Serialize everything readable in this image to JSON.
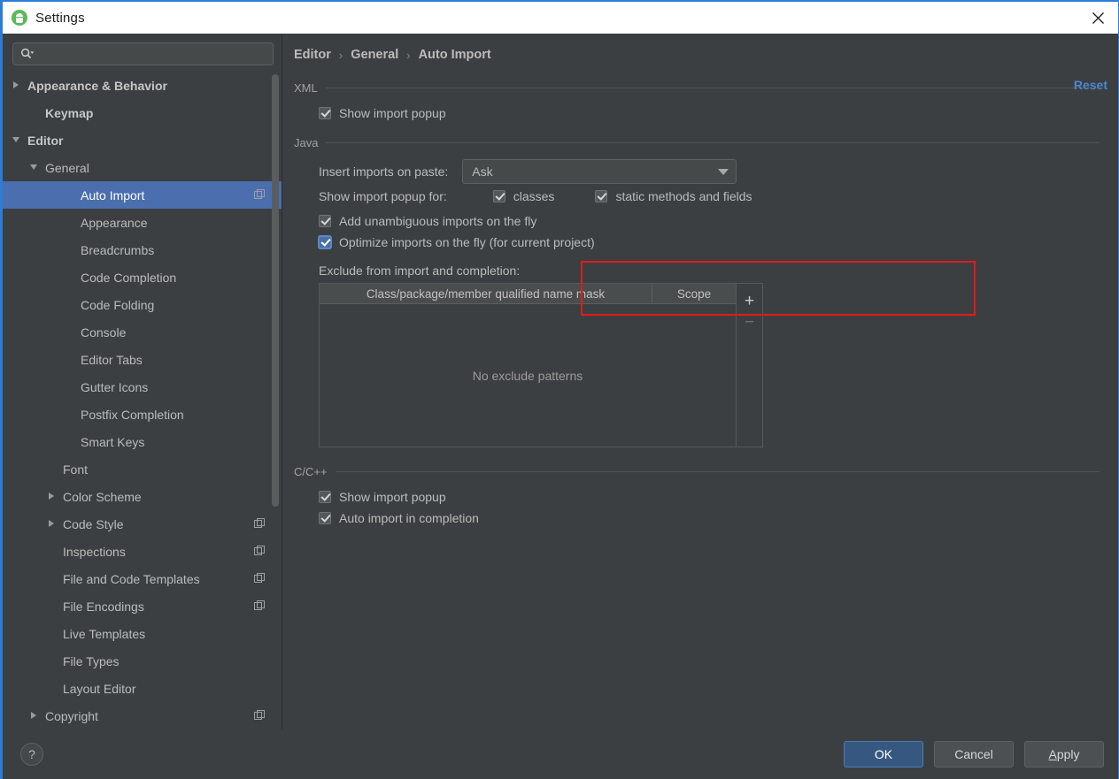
{
  "window": {
    "title": "Settings",
    "app_icon": "android-studio-icon",
    "close_icon": "close-icon",
    "accent_color": "#2d7cd6"
  },
  "sidebar": {
    "search": {
      "placeholder": "",
      "value": "",
      "icon": "search-icon"
    },
    "items": [
      {
        "label": "Appearance & Behavior",
        "indent": 0,
        "arrow": "right",
        "bold": true,
        "project_icon": false,
        "selected": false
      },
      {
        "label": "Keymap",
        "indent": 1,
        "arrow": "none",
        "bold": true,
        "project_icon": false,
        "selected": false
      },
      {
        "label": "Editor",
        "indent": 0,
        "arrow": "down",
        "bold": true,
        "project_icon": false,
        "selected": false
      },
      {
        "label": "General",
        "indent": 1,
        "arrow": "down",
        "bold": false,
        "project_icon": false,
        "selected": false
      },
      {
        "label": "Auto Import",
        "indent": 3,
        "arrow": "none",
        "bold": false,
        "project_icon": true,
        "selected": true
      },
      {
        "label": "Appearance",
        "indent": 3,
        "arrow": "none",
        "bold": false,
        "project_icon": false,
        "selected": false
      },
      {
        "label": "Breadcrumbs",
        "indent": 3,
        "arrow": "none",
        "bold": false,
        "project_icon": false,
        "selected": false
      },
      {
        "label": "Code Completion",
        "indent": 3,
        "arrow": "none",
        "bold": false,
        "project_icon": false,
        "selected": false
      },
      {
        "label": "Code Folding",
        "indent": 3,
        "arrow": "none",
        "bold": false,
        "project_icon": false,
        "selected": false
      },
      {
        "label": "Console",
        "indent": 3,
        "arrow": "none",
        "bold": false,
        "project_icon": false,
        "selected": false
      },
      {
        "label": "Editor Tabs",
        "indent": 3,
        "arrow": "none",
        "bold": false,
        "project_icon": false,
        "selected": false
      },
      {
        "label": "Gutter Icons",
        "indent": 3,
        "arrow": "none",
        "bold": false,
        "project_icon": false,
        "selected": false
      },
      {
        "label": "Postfix Completion",
        "indent": 3,
        "arrow": "none",
        "bold": false,
        "project_icon": false,
        "selected": false
      },
      {
        "label": "Smart Keys",
        "indent": 3,
        "arrow": "none",
        "bold": false,
        "project_icon": false,
        "selected": false
      },
      {
        "label": "Font",
        "indent": 2,
        "arrow": "none",
        "bold": false,
        "project_icon": false,
        "selected": false
      },
      {
        "label": "Color Scheme",
        "indent": 2,
        "arrow": "right",
        "bold": false,
        "project_icon": false,
        "selected": false
      },
      {
        "label": "Code Style",
        "indent": 2,
        "arrow": "right",
        "bold": false,
        "project_icon": true,
        "selected": false
      },
      {
        "label": "Inspections",
        "indent": 2,
        "arrow": "none",
        "bold": false,
        "project_icon": true,
        "selected": false
      },
      {
        "label": "File and Code Templates",
        "indent": 2,
        "arrow": "none",
        "bold": false,
        "project_icon": true,
        "selected": false
      },
      {
        "label": "File Encodings",
        "indent": 2,
        "arrow": "none",
        "bold": false,
        "project_icon": true,
        "selected": false
      },
      {
        "label": "Live Templates",
        "indent": 2,
        "arrow": "none",
        "bold": false,
        "project_icon": false,
        "selected": false
      },
      {
        "label": "File Types",
        "indent": 2,
        "arrow": "none",
        "bold": false,
        "project_icon": false,
        "selected": false
      },
      {
        "label": "Layout Editor",
        "indent": 2,
        "arrow": "none",
        "bold": false,
        "project_icon": false,
        "selected": false
      },
      {
        "label": "Copyright",
        "indent": 1,
        "arrow": "right",
        "bold": false,
        "project_icon": true,
        "selected": false
      }
    ]
  },
  "main": {
    "breadcrumb": {
      "items": [
        "Editor",
        "General",
        "Auto Import"
      ],
      "separator": "›"
    },
    "reset_label": "Reset",
    "reset_color": "#4a87d3",
    "groups": {
      "xml": {
        "title": "XML",
        "show_import_popup": {
          "label": "Show import popup",
          "checked": true
        }
      },
      "java": {
        "title": "Java",
        "insert_imports_label": "Insert imports on paste:",
        "insert_imports_value": "Ask",
        "show_import_popup_for_label": "Show import popup for:",
        "classes": {
          "label": "classes",
          "checked": true
        },
        "static_methods": {
          "label": "static methods and fields",
          "checked": true
        },
        "add_unambiguous": {
          "label": "Add unambiguous imports on the fly",
          "checked": true
        },
        "optimize_imports": {
          "label": "Optimize imports on the fly (for current project)",
          "checked": true,
          "focused": true
        },
        "exclude_label": "Exclude from import and completion:",
        "table": {
          "columns": [
            "Class/package/member qualified name mask",
            "Scope"
          ],
          "rows": [],
          "empty_text": "No exclude patterns",
          "add_label": "+",
          "remove_label": "−"
        }
      },
      "cpp": {
        "title": "C/C++",
        "show_import_popup": {
          "label": "Show import popup",
          "checked": true
        },
        "auto_import_completion": {
          "label": "Auto import in completion",
          "checked": true
        }
      }
    },
    "annotation": {
      "color": "#e01b1b",
      "shape": "rectangle"
    }
  },
  "footer": {
    "help_label": "?",
    "ok_label": "OK",
    "cancel_label": "Cancel",
    "apply_label": "Apply"
  }
}
